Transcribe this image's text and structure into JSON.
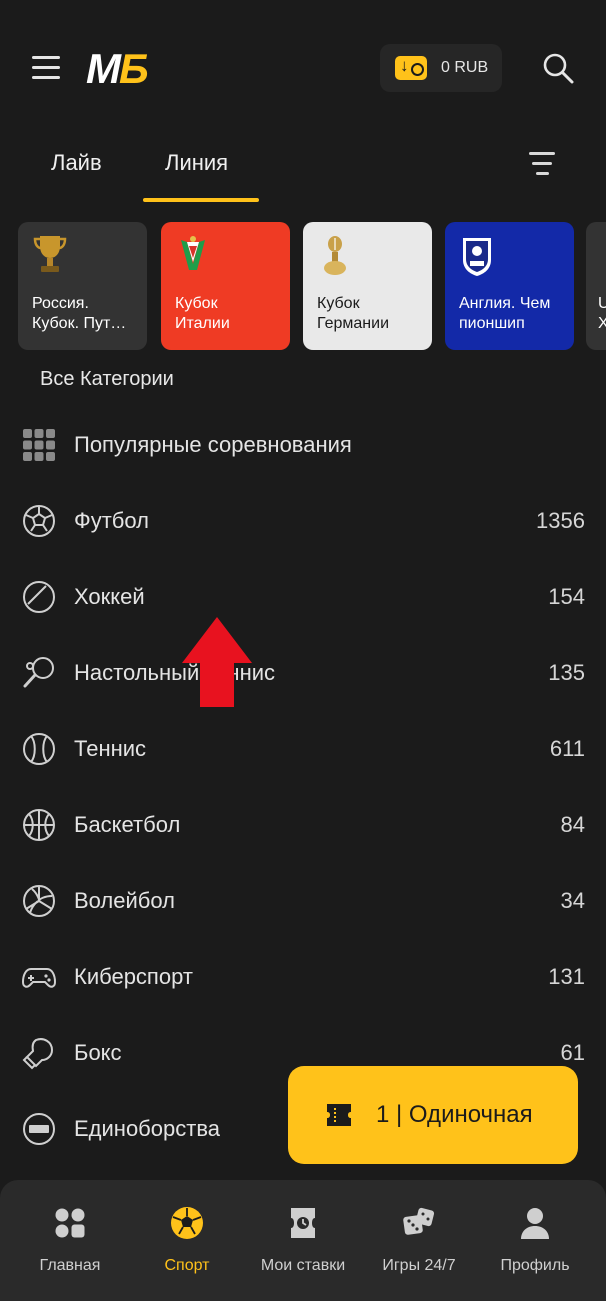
{
  "header": {
    "logo_m": "M",
    "logo_b": "Б",
    "balance": "0 RUB"
  },
  "tabs": [
    {
      "label": "Лайв"
    },
    {
      "label": "Линия",
      "active": true
    }
  ],
  "cards": [
    {
      "title_line1": "Россия.",
      "title_line2": "Кубок. Пут…",
      "bg": "#333333",
      "text": "#ffffff",
      "icon": "trophy-icon"
    },
    {
      "title_line1": "Кубок",
      "title_line2": "Италии",
      "bg": "#ef3b24",
      "text": "#ffffff",
      "icon": "italy-cup-icon"
    },
    {
      "title_line1": "Кубок",
      "title_line2": "Германии",
      "bg": "#e9e9e9",
      "text": "#1b1b1b",
      "icon": "dfb-pokal-icon"
    },
    {
      "title_line1": "Англия. Чем",
      "title_line2": "пионшип",
      "bg": "#1329a8",
      "text": "#ffffff",
      "icon": "efl-icon"
    },
    {
      "title_line1": "U",
      "title_line2": "Х",
      "bg": "#333333",
      "text": "#ffffff",
      "icon": "trophy-icon"
    }
  ],
  "all_categories": "Все Категории",
  "sports": [
    {
      "name": "Популярные соревнования",
      "count": "",
      "icon": "grid-icon"
    },
    {
      "name": "Футбол",
      "count": "1356",
      "icon": "football-icon"
    },
    {
      "name": "Хоккей",
      "count": "154",
      "icon": "hockey-puck-icon"
    },
    {
      "name": "Настольный теннис",
      "count": "135",
      "icon": "table-tennis-icon"
    },
    {
      "name": "Теннис",
      "count": "611",
      "icon": "tennis-ball-icon"
    },
    {
      "name": "Баскетбол",
      "count": "84",
      "icon": "basketball-icon"
    },
    {
      "name": "Волейбол",
      "count": "34",
      "icon": "volleyball-icon"
    },
    {
      "name": "Киберспорт",
      "count": "131",
      "icon": "gamepad-icon"
    },
    {
      "name": "Бокс",
      "count": "61",
      "icon": "boxing-glove-icon"
    },
    {
      "name": "Единоборства",
      "count": "",
      "icon": "ufc-icon"
    }
  ],
  "betslip": {
    "label": "1 | Одиночная"
  },
  "nav": [
    {
      "label": "Главная",
      "icon": "home-grid-icon"
    },
    {
      "label": "Спорт",
      "icon": "sport-ball-icon",
      "active": true
    },
    {
      "label": "Мои ставки",
      "icon": "bets-ticket-icon"
    },
    {
      "label": "Игры 24/7",
      "icon": "dice-icon"
    },
    {
      "label": "Профиль",
      "icon": "profile-icon"
    }
  ],
  "colors": {
    "accent": "#ffc21a",
    "background": "#1b1b1b",
    "annotation_arrow": "#e8121f"
  }
}
